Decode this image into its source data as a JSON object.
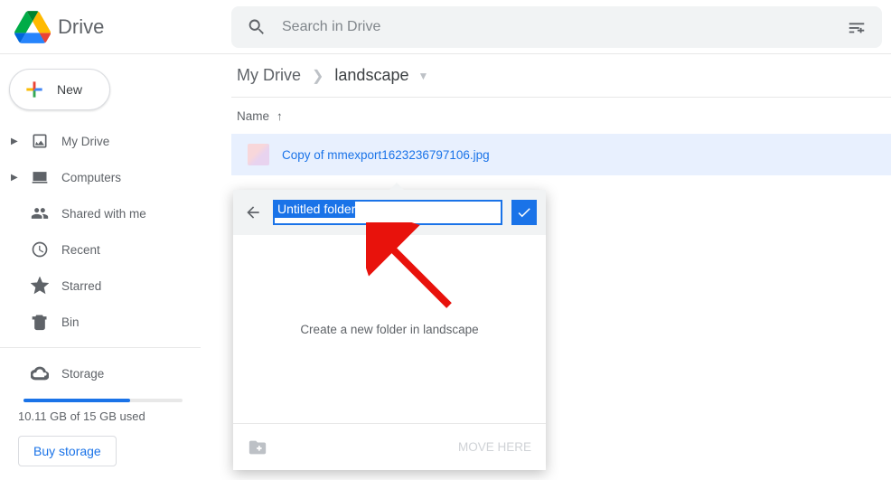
{
  "header": {
    "product": "Drive",
    "search_placeholder": "Search in Drive"
  },
  "sidebar": {
    "new_label": "New",
    "items": [
      {
        "label": "My Drive"
      },
      {
        "label": "Computers"
      },
      {
        "label": "Shared with me"
      },
      {
        "label": "Recent"
      },
      {
        "label": "Starred"
      },
      {
        "label": "Bin"
      }
    ],
    "storage_label": "Storage",
    "storage_usage": "10.11 GB of 15 GB used",
    "buy_label": "Buy storage"
  },
  "main": {
    "breadcrumb": {
      "root": "My Drive",
      "current": "landscape"
    },
    "column_header": "Name",
    "file_name": "Copy of mmexport1623236797106.jpg"
  },
  "dialog": {
    "input_value": "Untitled folder",
    "mid_text": "Create a new folder in landscape",
    "move_here": "MOVE HERE"
  }
}
